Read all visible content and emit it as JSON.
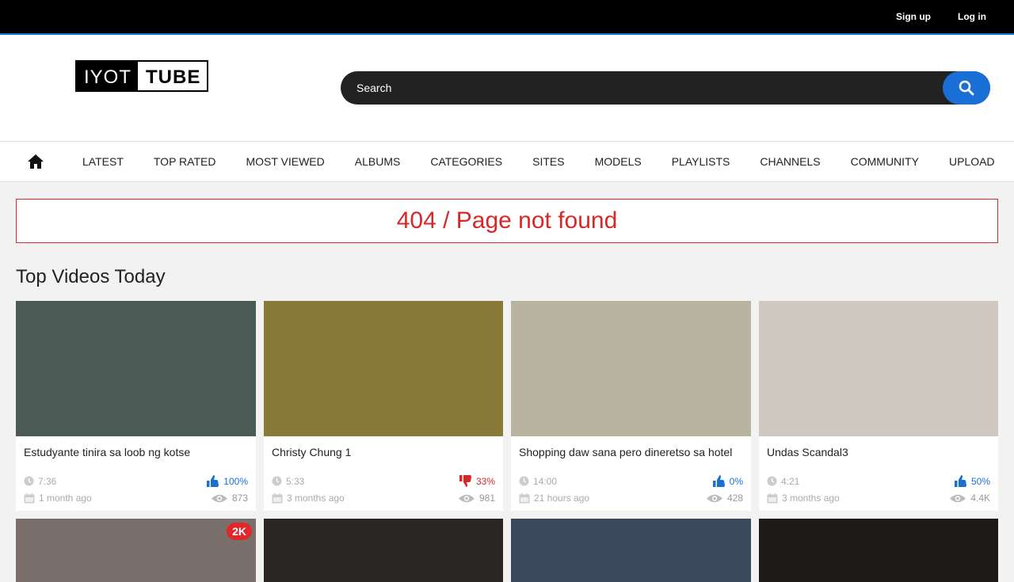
{
  "topbar": {
    "signup": "Sign up",
    "login": "Log in"
  },
  "logo": {
    "part1": "IYOT",
    "part2": "TUBE"
  },
  "search": {
    "placeholder": "Search"
  },
  "nav": [
    "LATEST",
    "TOP RATED",
    "MOST VIEWED",
    "ALBUMS",
    "CATEGORIES",
    "SITES",
    "MODELS",
    "PLAYLISTS",
    "CHANNELS",
    "COMMUNITY",
    "UPLOAD"
  ],
  "error": "404 / Page not found",
  "section_title": "Top Videos Today",
  "videos": [
    {
      "title": "Estudyante tinira sa loob ng kotse",
      "duration": "7:36",
      "rating": "100%",
      "rating_type": "pos",
      "age": "1 month ago",
      "views": "873",
      "thumb_color": "#4b5a55"
    },
    {
      "title": "Christy Chung 1",
      "duration": "5:33",
      "rating": "33%",
      "rating_type": "neg",
      "age": "3 months ago",
      "views": "981",
      "thumb_color": "#8a7a3a"
    },
    {
      "title": "Shopping daw sana pero dineretso sa hotel",
      "duration": "14:00",
      "rating": "0%",
      "rating_type": "pos",
      "age": "21 hours ago",
      "views": "428",
      "thumb_color": "#b9b4a0"
    },
    {
      "title": "Undas Scandal3",
      "duration": "4:21",
      "rating": "50%",
      "rating_type": "pos",
      "age": "3 months ago",
      "views": "4.4K",
      "thumb_color": "#cfc8c0"
    }
  ],
  "row2": [
    {
      "badge": "2K",
      "thumb_color": "#7a6f6a"
    },
    {
      "badge": "",
      "thumb_color": "#2a2624"
    },
    {
      "badge": "",
      "thumb_color": "#3a4a5c"
    },
    {
      "badge": "",
      "thumb_color": "#1e1a18"
    }
  ]
}
